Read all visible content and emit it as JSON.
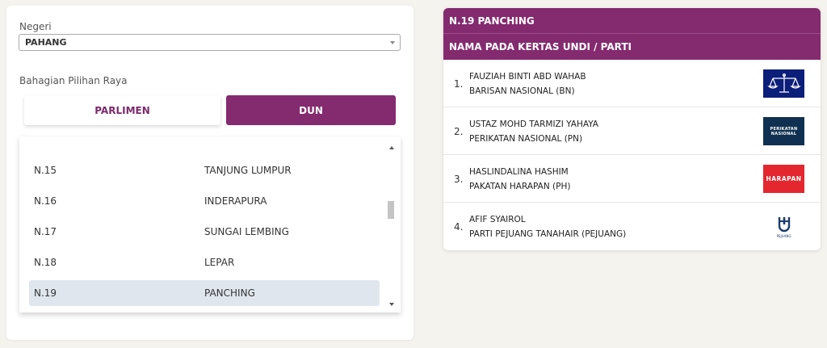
{
  "filters": {
    "state_label": "Negeri",
    "state_value": "PAHANG",
    "division_label": "Bahagian Pilihan Raya",
    "tabs": [
      {
        "label": "PARLIMEN",
        "active": false
      },
      {
        "label": "DUN",
        "active": true
      }
    ]
  },
  "constituency_list": {
    "items": [
      {
        "code": "N.15",
        "name": "TANJUNG LUMPUR"
      },
      {
        "code": "N.16",
        "name": "INDERAPURA"
      },
      {
        "code": "N.17",
        "name": "SUNGAI LEMBING"
      },
      {
        "code": "N.18",
        "name": "LEPAR"
      },
      {
        "code": "N.19",
        "name": "PANCHING"
      }
    ],
    "selected_index": 4
  },
  "ballot": {
    "title": "N.19 PANCHING",
    "subtitle": "NAMA PADA KERTAS UNDI / PARTI",
    "candidates": [
      {
        "number": "1.",
        "name": "FAUZIAH BINTI ABD WAHAB",
        "party": "BARISAN NASIONAL (BN)",
        "logo": "bn-scales-logo"
      },
      {
        "number": "2.",
        "name": "USTAZ MOHD TARMIZI YAHAYA",
        "party": "PERIKATAN NASIONAL (PN)",
        "logo": "pn-logo"
      },
      {
        "number": "3.",
        "name": "HASLINDALINA HASHIM",
        "party": "PAKATAN HARAPAN (PH)",
        "logo": "ph-logo"
      },
      {
        "number": "4.",
        "name": "AFIF SYAIROL",
        "party": "PARTI PEJUANG TANAHAIR (PEJUANG)",
        "logo": "pejuang-logo"
      }
    ],
    "logo_text": {
      "pn_line1": "PERIKATAN",
      "pn_line2": "NASIONAL",
      "ph": "HARAPAN",
      "pejuang": "PEJUANG"
    }
  },
  "colors": {
    "brand_purple": "#842a6f",
    "selected_row": "#e0e6ee",
    "page_background": "#f4f3ee"
  }
}
